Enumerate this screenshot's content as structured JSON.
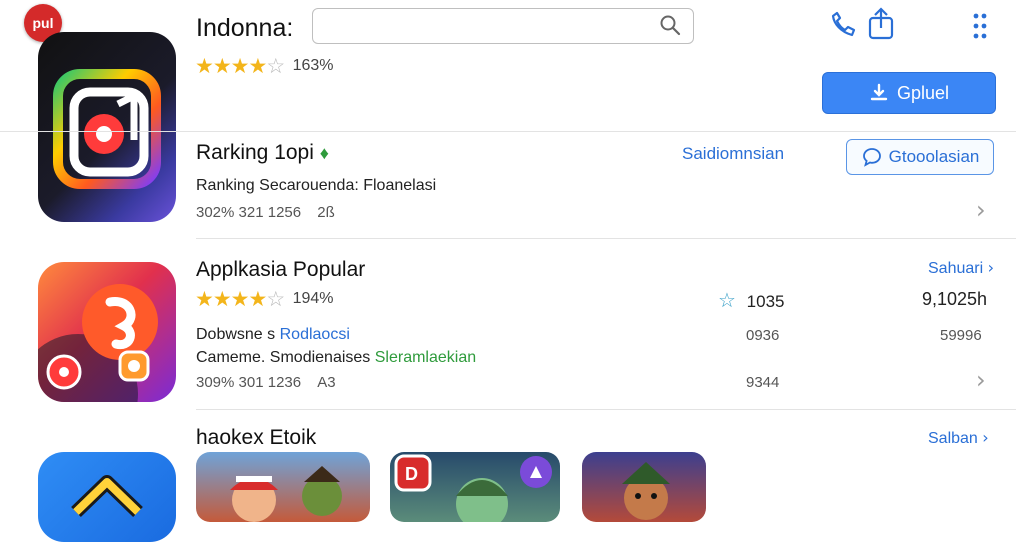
{
  "header": {
    "badge": "pul",
    "title": "Indonna:",
    "search_placeholder": "",
    "rating_text": "163%",
    "download_button": "Gpluel"
  },
  "ranking": {
    "title": "Rarking 1opi",
    "link": "Saidiomnsian",
    "button": "Gtooolasian",
    "subtitle": "Ranking Secarouenda: Floanelasi",
    "meta": "302% 321 1256",
    "meta2": "2ß"
  },
  "popular": {
    "title": "Applkasia Popular",
    "link": "Sahuari",
    "rating_text": "194%",
    "stat_label": "1035",
    "stat_right": "9,1025h",
    "line1_prefix": "Dobwsne s",
    "line1_link": "Rodlaocsi",
    "line1_mid": "0936",
    "line1_right": "59996",
    "line2_prefix": "Cameme. Smodienaises",
    "line2_green": "Sleramlaekian",
    "meta": "309% 301 1236",
    "meta2": "A3",
    "meta_right": "9344"
  },
  "section3": {
    "title": "haokex Etoik",
    "link": "Salban"
  },
  "icons": {
    "search": "search-icon",
    "share": "share-icon",
    "more": "more-icon",
    "phone": "phone-icon",
    "chat": "chat-icon",
    "star_outline": "star-outline-icon",
    "chevron": "chevron-right-icon"
  },
  "colors": {
    "accent": "#2a6fd6",
    "button": "#3b86f5",
    "star": "#f3b51b"
  }
}
